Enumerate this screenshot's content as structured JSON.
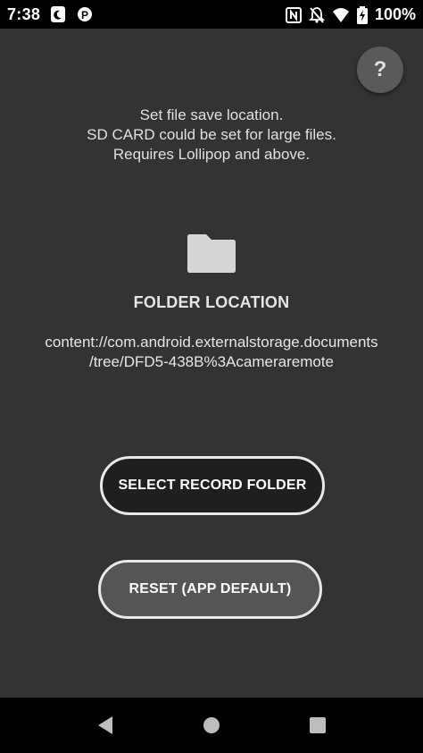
{
  "status_bar": {
    "time": "7:38",
    "battery_percent": "100%",
    "left_icons": [
      "moon-notification-icon",
      "parking-p-icon"
    ],
    "right_icons": [
      "nfc-icon",
      "notifications-off-icon",
      "wifi-icon",
      "battery-charging-icon"
    ]
  },
  "help": {
    "label": "?"
  },
  "info_lines": [
    "Set file save location.",
    "SD CARD could be set for large files.",
    "Requires Lollipop and above."
  ],
  "folder": {
    "label": "FOLDER LOCATION",
    "path_lines": [
      "content://com.android.externalstorage.documents",
      "/tree/DFD5-438B%3Acameraremote"
    ]
  },
  "buttons": {
    "select_folder": "SELECT RECORD FOLDER",
    "reset_default": "RESET (APP DEFAULT)"
  },
  "colors": {
    "app_background": "#333333",
    "select_button_bg": "#1f1f1f",
    "reset_button_bg": "#555555",
    "button_border": "#e8e8e8"
  }
}
